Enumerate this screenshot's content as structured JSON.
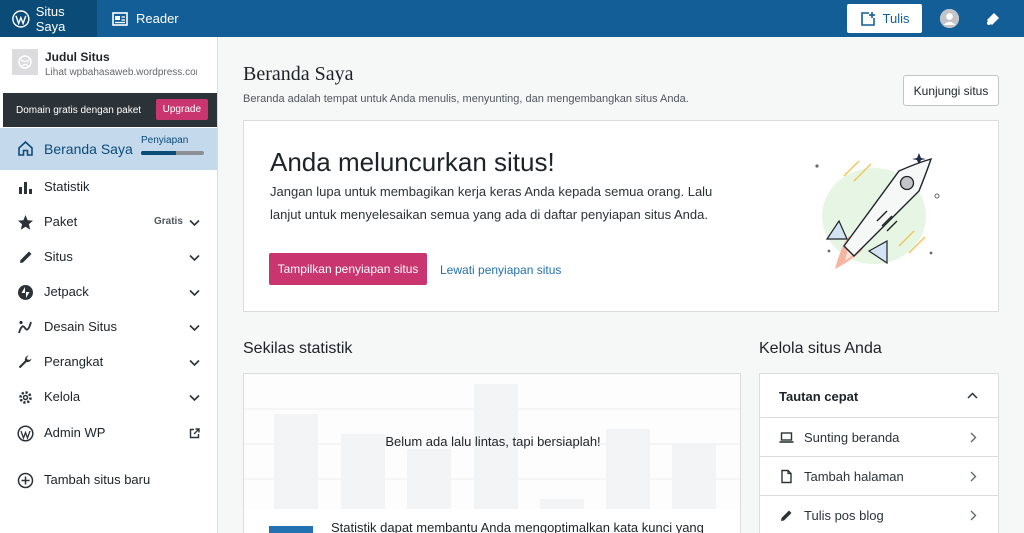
{
  "topbar": {
    "site_label": "Situs Saya",
    "reader_label": "Reader",
    "write_label": "Tulis"
  },
  "sidebar": {
    "site_title": "Judul Situs",
    "site_url": "Lihat wpbahasaweb.wordpress.com",
    "domain_banner": "Domain gratis dengan paket",
    "upgrade_label": "Upgrade",
    "setup_label": "Penyiapan",
    "setup_progress": 0.55,
    "plan_badge": "Gratis",
    "items": [
      {
        "label": "Beranda Saya",
        "icon": "home-icon"
      },
      {
        "label": "Statistik",
        "icon": "stats-icon"
      },
      {
        "label": "Paket",
        "icon": "star-icon"
      },
      {
        "label": "Situs",
        "icon": "pencil-icon"
      },
      {
        "label": "Jetpack",
        "icon": "jetpack-icon"
      },
      {
        "label": "Desain Situs",
        "icon": "brush-icon"
      },
      {
        "label": "Perangkat",
        "icon": "wrench-icon"
      },
      {
        "label": "Kelola",
        "icon": "gear-icon"
      },
      {
        "label": "Admin WP",
        "icon": "wordpress-icon"
      },
      {
        "label": "Tambah situs baru",
        "icon": "plus-circle-icon"
      }
    ]
  },
  "main": {
    "title": "Beranda Saya",
    "subtitle": "Beranda adalah tempat untuk Anda menulis, menyunting, dan mengembangkan situs Anda.",
    "visit_button": "Kunjungi situs",
    "launch": {
      "title": "Anda meluncurkan situs!",
      "description": "Jangan lupa untuk membagikan kerja keras Anda kepada semua orang. Lalu lanjut untuk menyelesaikan semua yang ada di daftar penyiapan situs Anda.",
      "primary_button": "Tampilkan penyiapan situs",
      "skip_link": "Lewati penyiapan situs"
    },
    "stats": {
      "title": "Sekilas statistik",
      "empty_text": "Belum ada lalu lintas, tapi bersiaplah!",
      "teaser": "Statistik dapat membantu Anda mengoptimalkan kata kunci yang"
    },
    "manage": {
      "title": "Kelola situs Anda",
      "quick_links_title": "Tautan cepat",
      "links": [
        {
          "label": "Sunting beranda",
          "icon": "laptop-icon"
        },
        {
          "label": "Tambah halaman",
          "icon": "page-icon"
        },
        {
          "label": "Tulis pos blog",
          "icon": "pencil-icon"
        }
      ]
    }
  },
  "colors": {
    "topbar": "#135e96",
    "accent_pink": "#c9356e",
    "link_blue": "#2271b1",
    "active_nav": "#c5d9ed"
  }
}
